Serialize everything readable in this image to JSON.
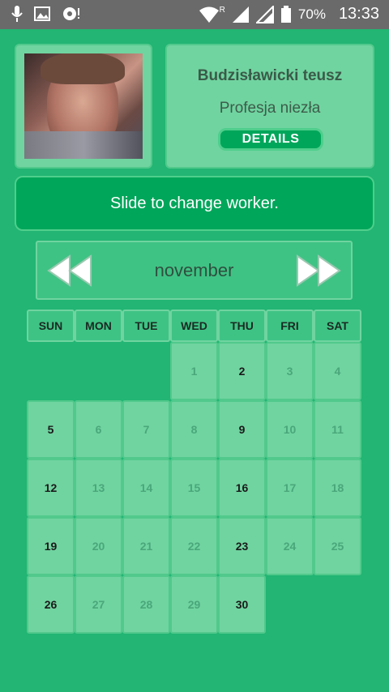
{
  "statusbar": {
    "battery_percent": "70%",
    "time": "13:33",
    "network_letter": "R"
  },
  "worker": {
    "name": "Budzisławicki teusz",
    "role": "Profesja niezła",
    "details_label": "DETAILS"
  },
  "banner": {
    "text": "Slide to change worker."
  },
  "calendar": {
    "month": "november",
    "weekdays": [
      "SUN",
      "MON",
      "TUE",
      "WED",
      "THU",
      "FRI",
      "SAT"
    ],
    "days": [
      {
        "n": "1",
        "col": 3,
        "row": 0,
        "active": false
      },
      {
        "n": "2",
        "col": 4,
        "row": 0,
        "active": true
      },
      {
        "n": "3",
        "col": 5,
        "row": 0,
        "active": false
      },
      {
        "n": "4",
        "col": 6,
        "row": 0,
        "active": false
      },
      {
        "n": "5",
        "col": 0,
        "row": 1,
        "active": true
      },
      {
        "n": "6",
        "col": 1,
        "row": 1,
        "active": false
      },
      {
        "n": "7",
        "col": 2,
        "row": 1,
        "active": false
      },
      {
        "n": "8",
        "col": 3,
        "row": 1,
        "active": false
      },
      {
        "n": "9",
        "col": 4,
        "row": 1,
        "active": true
      },
      {
        "n": "10",
        "col": 5,
        "row": 1,
        "active": false
      },
      {
        "n": "11",
        "col": 6,
        "row": 1,
        "active": false
      },
      {
        "n": "12",
        "col": 0,
        "row": 2,
        "active": true
      },
      {
        "n": "13",
        "col": 1,
        "row": 2,
        "active": false
      },
      {
        "n": "14",
        "col": 2,
        "row": 2,
        "active": false
      },
      {
        "n": "15",
        "col": 3,
        "row": 2,
        "active": false
      },
      {
        "n": "16",
        "col": 4,
        "row": 2,
        "active": true
      },
      {
        "n": "17",
        "col": 5,
        "row": 2,
        "active": false
      },
      {
        "n": "18",
        "col": 6,
        "row": 2,
        "active": false
      },
      {
        "n": "19",
        "col": 0,
        "row": 3,
        "active": true
      },
      {
        "n": "20",
        "col": 1,
        "row": 3,
        "active": false
      },
      {
        "n": "21",
        "col": 2,
        "row": 3,
        "active": false
      },
      {
        "n": "22",
        "col": 3,
        "row": 3,
        "active": false
      },
      {
        "n": "23",
        "col": 4,
        "row": 3,
        "active": true
      },
      {
        "n": "24",
        "col": 5,
        "row": 3,
        "active": false
      },
      {
        "n": "25",
        "col": 6,
        "row": 3,
        "active": false
      },
      {
        "n": "26",
        "col": 0,
        "row": 4,
        "active": true
      },
      {
        "n": "27",
        "col": 1,
        "row": 4,
        "active": false
      },
      {
        "n": "28",
        "col": 2,
        "row": 4,
        "active": false
      },
      {
        "n": "29",
        "col": 3,
        "row": 4,
        "active": false
      },
      {
        "n": "30",
        "col": 4,
        "row": 4,
        "active": true
      }
    ]
  },
  "icons": {
    "status_left": [
      "microphone-icon",
      "image-icon",
      "lens-icon"
    ],
    "status_right": [
      "wifi-icon",
      "signal-icon",
      "signal-icon",
      "battery-icon"
    ],
    "nav": [
      "rewind-icon",
      "fast-forward-icon"
    ]
  },
  "colors": {
    "background": "#22b573",
    "card": "#70d4a0",
    "accent": "#00a65a",
    "statusbar": "#6a6a6a"
  }
}
